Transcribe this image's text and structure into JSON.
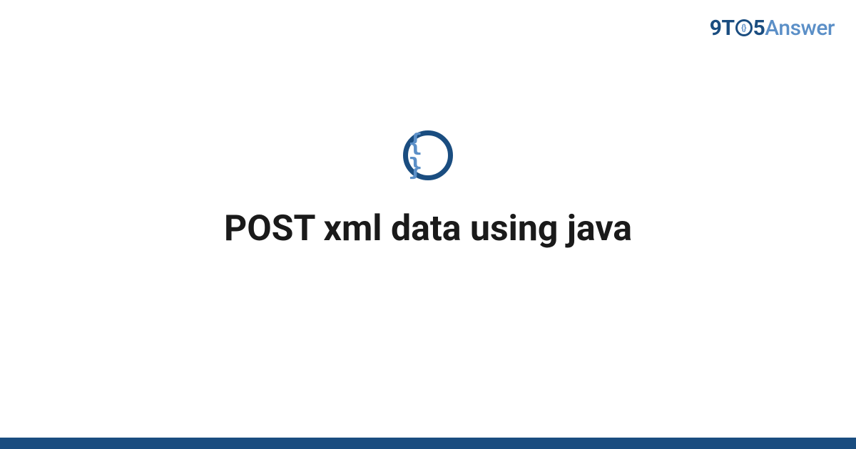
{
  "logo": {
    "part1": "9T",
    "o_inner": "{}",
    "part2": "5",
    "part3": "Answer"
  },
  "category": {
    "icon_name": "code-braces-icon",
    "icon_text": "{ }"
  },
  "page": {
    "title": "POST xml data using java"
  },
  "colors": {
    "brand_dark": "#1a4d80",
    "brand_light": "#5b8fc7"
  }
}
